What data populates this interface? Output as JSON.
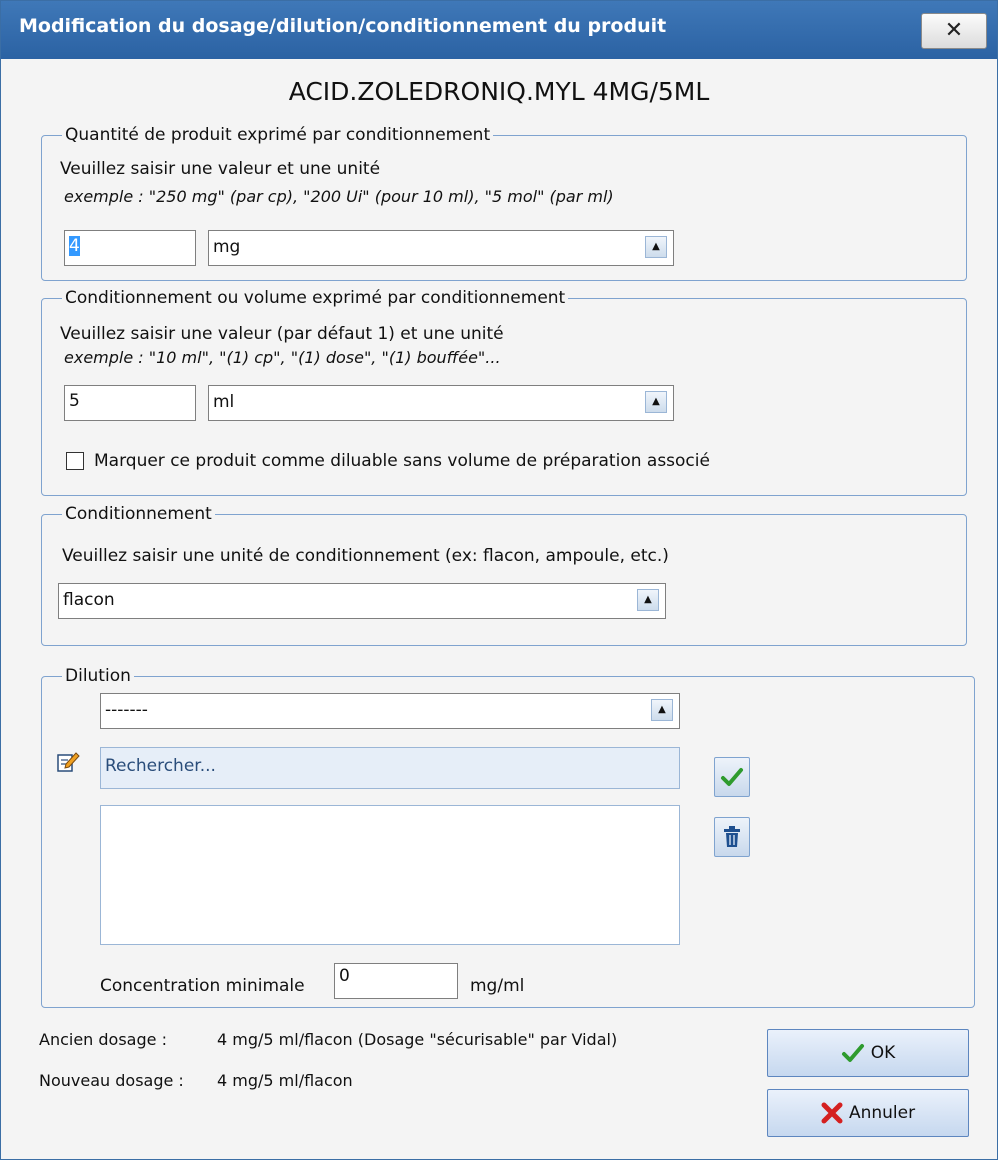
{
  "window": {
    "title": "Modification du dosage/dilution/conditionnement du produit",
    "close_label": "✕"
  },
  "product": {
    "name": "ACID.ZOLEDRONIQ.MYL 4MG/5ML"
  },
  "quantity_section": {
    "legend": "Quantité de produit exprimé par conditionnement",
    "instruction": "Veuillez saisir une valeur et une unité",
    "example": "exemple : \"250 mg\" (par cp), \"200 Ui\" (pour 10 ml), \"5 mol\" (par ml)",
    "value": "4",
    "unit": "mg"
  },
  "volume_section": {
    "legend": "Conditionnement ou volume exprimé par conditionnement",
    "instruction": "Veuillez saisir une valeur (par défaut 1) et une unité",
    "example": "exemple : \"10 ml\", \"(1) cp\", \"(1) dose\", \"(1) bouffée\"...",
    "value": "5",
    "unit": "ml",
    "checkbox_label": "Marquer ce produit comme diluable sans volume de préparation associé",
    "checkbox_checked": false
  },
  "packaging_section": {
    "legend": "Conditionnement",
    "instruction": "Veuillez saisir une unité de conditionnement (ex: flacon, ampoule, etc.)",
    "unit": "flacon"
  },
  "dilution_section": {
    "legend": "Dilution",
    "select_value": "-------",
    "search_placeholder": "Rechercher...",
    "concentration_label": "Concentration minimale",
    "concentration_value": "0",
    "concentration_unit": "mg/ml"
  },
  "footer": {
    "old_label": "Ancien dosage :",
    "old_value": "4 mg/5 ml/flacon (Dosage \"sécurisable\" par Vidal)",
    "new_label": "Nouveau dosage :",
    "new_value": "4 mg/5 ml/flacon",
    "ok_label": "OK",
    "cancel_label": "Annuler"
  },
  "icons": {
    "close": "close-icon",
    "dropdown": "dropdown-arrow-icon",
    "edit": "pencil-icon",
    "validate": "checkmark-icon",
    "delete": "trash-icon",
    "ok": "checkmark-icon",
    "cancel": "red-x-icon"
  },
  "colors": {
    "titlebar": "#2b62a3",
    "group_border": "#7fa3cf",
    "check_green": "#2e9b2e",
    "cancel_red": "#d42020",
    "selection": "#3399ff"
  }
}
